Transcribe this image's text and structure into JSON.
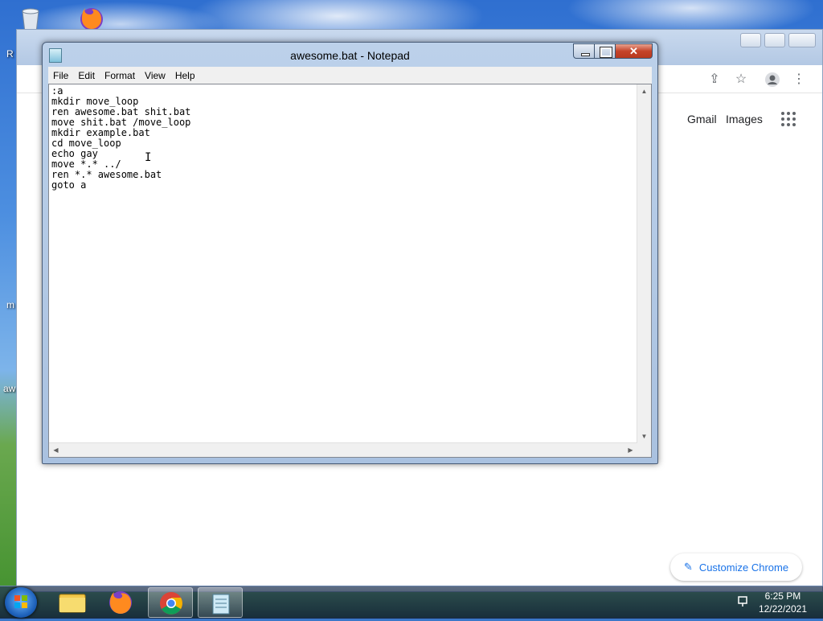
{
  "desktop": {
    "labels": [
      "R",
      "m",
      "aw"
    ]
  },
  "chrome": {
    "links": {
      "gmail": "Gmail",
      "images": "Images"
    },
    "customize_label": "Customize Chrome"
  },
  "notepad": {
    "title": "awesome.bat - Notepad",
    "menu": [
      "File",
      "Edit",
      "Format",
      "View",
      "Help"
    ],
    "content": ":a\nmkdir move_loop\nren awesome.bat shit.bat\nmove shit.bat /move_loop\nmkdir example.bat\ncd move_loop\necho gay\nmove *.* ../\nren *.* awesome.bat\ngoto a"
  },
  "taskbar": {
    "time": "6:25 PM",
    "date": "12/22/2021"
  },
  "colors": {
    "chrome_accent": "#1a73e8",
    "close_red": "#c5442a",
    "taskbar": "#1f3557"
  }
}
